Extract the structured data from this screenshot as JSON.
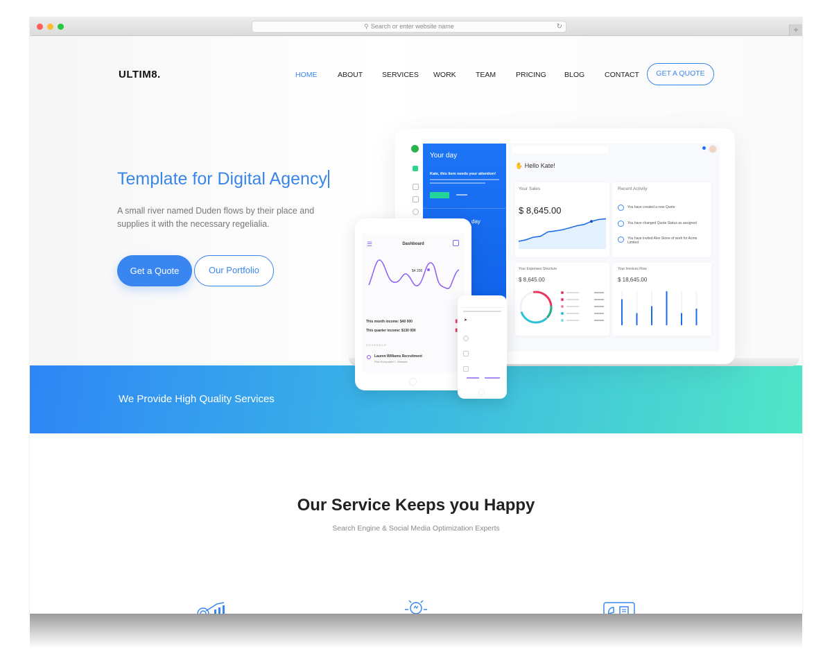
{
  "browser": {
    "address_placeholder": "Search or enter website name",
    "new_tab_symbol": "+"
  },
  "header": {
    "logo": "ULTIM8.",
    "nav": [
      {
        "label": "HOME",
        "active": true
      },
      {
        "label": "ABOUT",
        "active": false
      },
      {
        "label": "SERVICES",
        "active": false
      },
      {
        "label": "WORK",
        "active": false
      },
      {
        "label": "TEAM",
        "active": false
      },
      {
        "label": "PRICING",
        "active": false
      },
      {
        "label": "BLOG",
        "active": false
      },
      {
        "label": "CONTACT",
        "active": false
      }
    ],
    "cta": "GET A QUOTE"
  },
  "hero": {
    "title": "Template for Digital Agency",
    "description": "A small river named Duden flows by their place and supplies it with the necessary regelialia.",
    "primary_button": "Get a Quote",
    "secondary_button": "Our Portfolio"
  },
  "mockup": {
    "your_day": "Your day",
    "attention": "Kate, this item needs your attention!",
    "greeting": "Hello Kate!",
    "sales_label": "Your Sales",
    "sales_value": "$ 8,645.00",
    "recent_activity": "Recent Activity",
    "activity": [
      "You have created a new Quote",
      "You have changed Quote Status as assigned",
      "You have invited Alex Stone of work for Acme Limited"
    ],
    "expenses_label": "Your Expenses Structure",
    "expenses_value": "$ 8,645.00",
    "invoices_label": "Your Invoices Flow",
    "invoices_value": "$ 18,645.00",
    "tablet_title": "Dashboard",
    "tablet_point_label": "$4 200",
    "month_income": "This month income: $40 000",
    "quarter_income": "This quarter income: $130 000",
    "schedule_label": "SCHEDULE",
    "event_title": "Lauren Williams Recruitment",
    "event_location": "Plac Europejski 1, Warsaw",
    "partial_day": "day",
    "expense_colors": [
      "#e8385f",
      "#e8385f",
      "#ef8a9c",
      "#2bc3d4",
      "#7fd8ea"
    ],
    "invoice_bars": [
      0.75,
      0.35,
      0.55,
      0.98,
      0.35,
      0.48
    ],
    "sales_line": [
      0.2,
      0.25,
      0.33,
      0.36,
      0.5,
      0.53,
      0.57,
      0.63,
      0.7,
      0.74,
      0.84,
      0.9,
      0.92
    ]
  },
  "banner": {
    "text": "We Provide High Quality Services"
  },
  "services": {
    "title": "Our Service Keeps you Happy",
    "subtitle": "Search Engine & Social Media Optimization Experts",
    "icons": [
      "growth-chart-icon",
      "lightbulb-icon",
      "report-icon"
    ]
  }
}
